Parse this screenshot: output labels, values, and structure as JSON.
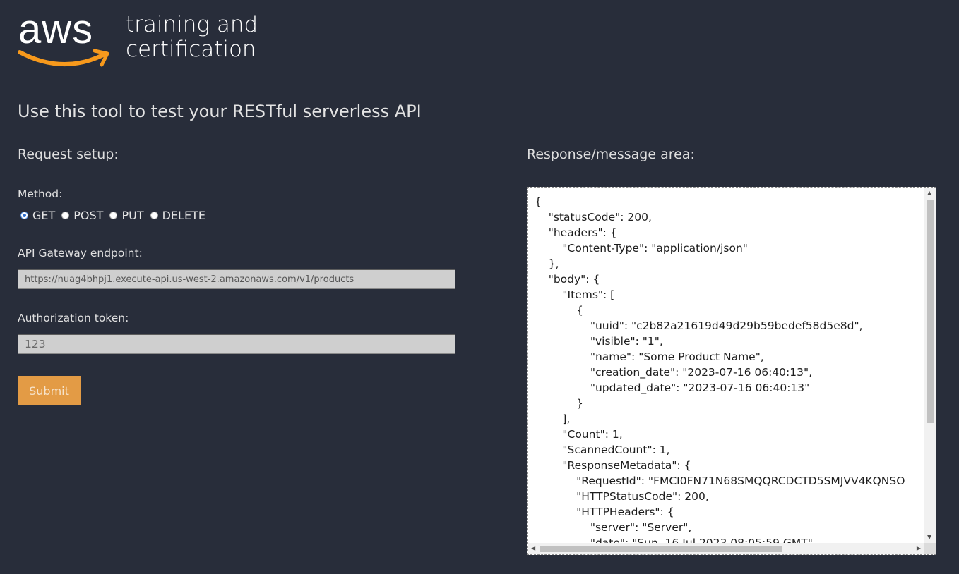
{
  "logo": {
    "wordmark": "aws",
    "tagline_line1": "training and",
    "tagline_line2": "certification",
    "smile_color": "#f7991c"
  },
  "page_title": "Use this tool to test your RESTful serverless API",
  "request": {
    "heading": "Request setup:",
    "method_label": "Method:",
    "methods": [
      {
        "label": "GET",
        "selected": true
      },
      {
        "label": "POST",
        "selected": false
      },
      {
        "label": "PUT",
        "selected": false
      },
      {
        "label": "DELETE",
        "selected": false
      }
    ],
    "endpoint_label": "API Gateway endpoint:",
    "endpoint_value": "https://nuag4bhpj1.execute-api.us-west-2.amazonaws.com/v1/products",
    "auth_label": "Authorization token:",
    "auth_value": "123",
    "submit_label": "Submit",
    "submit_color": "#e39b45"
  },
  "response": {
    "heading": "Response/message area:",
    "body": "{\n    \"statusCode\": 200,\n    \"headers\": {\n        \"Content-Type\": \"application/json\"\n    },\n    \"body\": {\n        \"Items\": [\n            {\n                \"uuid\": \"c2b82a21619d49d29b59bedef58d5e8d\",\n                \"visible\": \"1\",\n                \"name\": \"Some Product Name\",\n                \"creation_date\": \"2023-07-16 06:40:13\",\n                \"updated_date\": \"2023-07-16 06:40:13\"\n            }\n        ],\n        \"Count\": 1,\n        \"ScannedCount\": 1,\n        \"ResponseMetadata\": {\n            \"RequestId\": \"FMCI0FN71N68SMQQRCDCTD5SMJVV4KQNSO\n            \"HTTPStatusCode\": 200,\n            \"HTTPHeaders\": {\n                \"server\": \"Server\",\n                \"date\": \"Sun, 16 Jul 2023 08:05:59 GMT\","
  }
}
